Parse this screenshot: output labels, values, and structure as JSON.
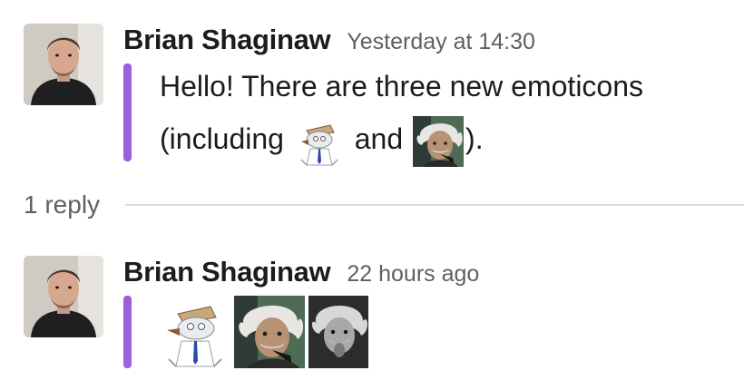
{
  "messages": [
    {
      "author": "Brian Shaginaw",
      "timestamp": "Yesterday at 14:30",
      "text_line1": "Hello! There are three new emoticons",
      "text_line2_start": "(including",
      "text_line2_mid": "and",
      "text_line2_end": ").",
      "emoji_icons": [
        "cartoon-character-emoji-icon",
        "einstein-pipe-emoji-icon"
      ]
    },
    {
      "author": "Brian Shaginaw",
      "timestamp": "22 hours ago",
      "emoji_icons": [
        "cartoon-character-emoji-icon",
        "einstein-pipe-emoji-icon",
        "einstein-tongue-emoji-icon"
      ]
    }
  ],
  "thread": {
    "reply_count": "1 reply"
  },
  "colors": {
    "quote_bar": "#9b5fe0",
    "author_text": "#1d1c1d",
    "timestamp_text": "#616061",
    "divider": "#dddddd"
  }
}
